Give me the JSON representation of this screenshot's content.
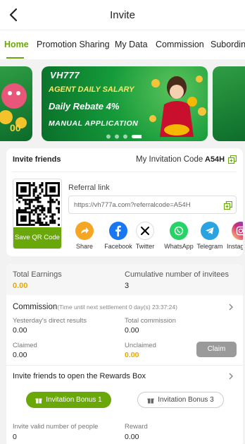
{
  "header": {
    "title": "Invite"
  },
  "tabs": [
    "Home",
    "Promotion Sharing",
    "My Data",
    "Commission",
    "Subordinate"
  ],
  "banner": {
    "logo": "VH777",
    "line1": "AGENT DAILY SALARY",
    "line2": "Daily Rebate 4%",
    "line3": "MANUAL APPLICATION",
    "slide_count": 4,
    "active_slide": 4
  },
  "invite": {
    "title": "Invite friends",
    "code_label": "My Invitation Code",
    "code": "A54H",
    "save_qr": "Save QR Code",
    "referral_label": "Referral link",
    "referral_url": "https://vh777a.com?referralcode=A54H",
    "share": [
      {
        "name": "Share",
        "icon": "share-arrow-icon",
        "color": "#f5a623"
      },
      {
        "name": "Facebook",
        "icon": "facebook-icon",
        "color": "#1877f2"
      },
      {
        "name": "Twitter",
        "icon": "x-twitter-icon",
        "color": "#000000"
      },
      {
        "name": "WhatsApp",
        "icon": "whatsapp-icon",
        "color": "#25d366"
      },
      {
        "name": "Telegram",
        "icon": "telegram-icon",
        "color": "#2aa3e0"
      },
      {
        "name": "Instagram",
        "icon": "instagram-icon",
        "color": "#d62976"
      }
    ]
  },
  "stats": {
    "total_earnings_label": "Total Earnings",
    "total_earnings": "0.00",
    "invitees_label": "Cumulative number of invitees",
    "invitees": "3"
  },
  "commission": {
    "title": "Commission",
    "note": "(Time until next settlement 0 day(s) 23:37:24)",
    "yesterday_label": "Yesterday's direct results",
    "yesterday": "0.00",
    "total_label": "Total commission",
    "total": "0.00",
    "claimed_label": "Claimed",
    "claimed": "0.00",
    "unclaimed_label": "Unclaimed",
    "unclaimed": "0.00",
    "claim_button": "Claim"
  },
  "rewards": {
    "title": "Invite friends to open the Rewards Box",
    "bonus1": "Invitation Bonus 1",
    "bonus3": "Invitation Bonus 3",
    "valid_label": "Invite valid number of people",
    "valid": "0",
    "reward_label": "Reward",
    "reward": "0.00"
  },
  "colors": {
    "accent": "#6aa80a",
    "highlight": "#e6a800"
  }
}
